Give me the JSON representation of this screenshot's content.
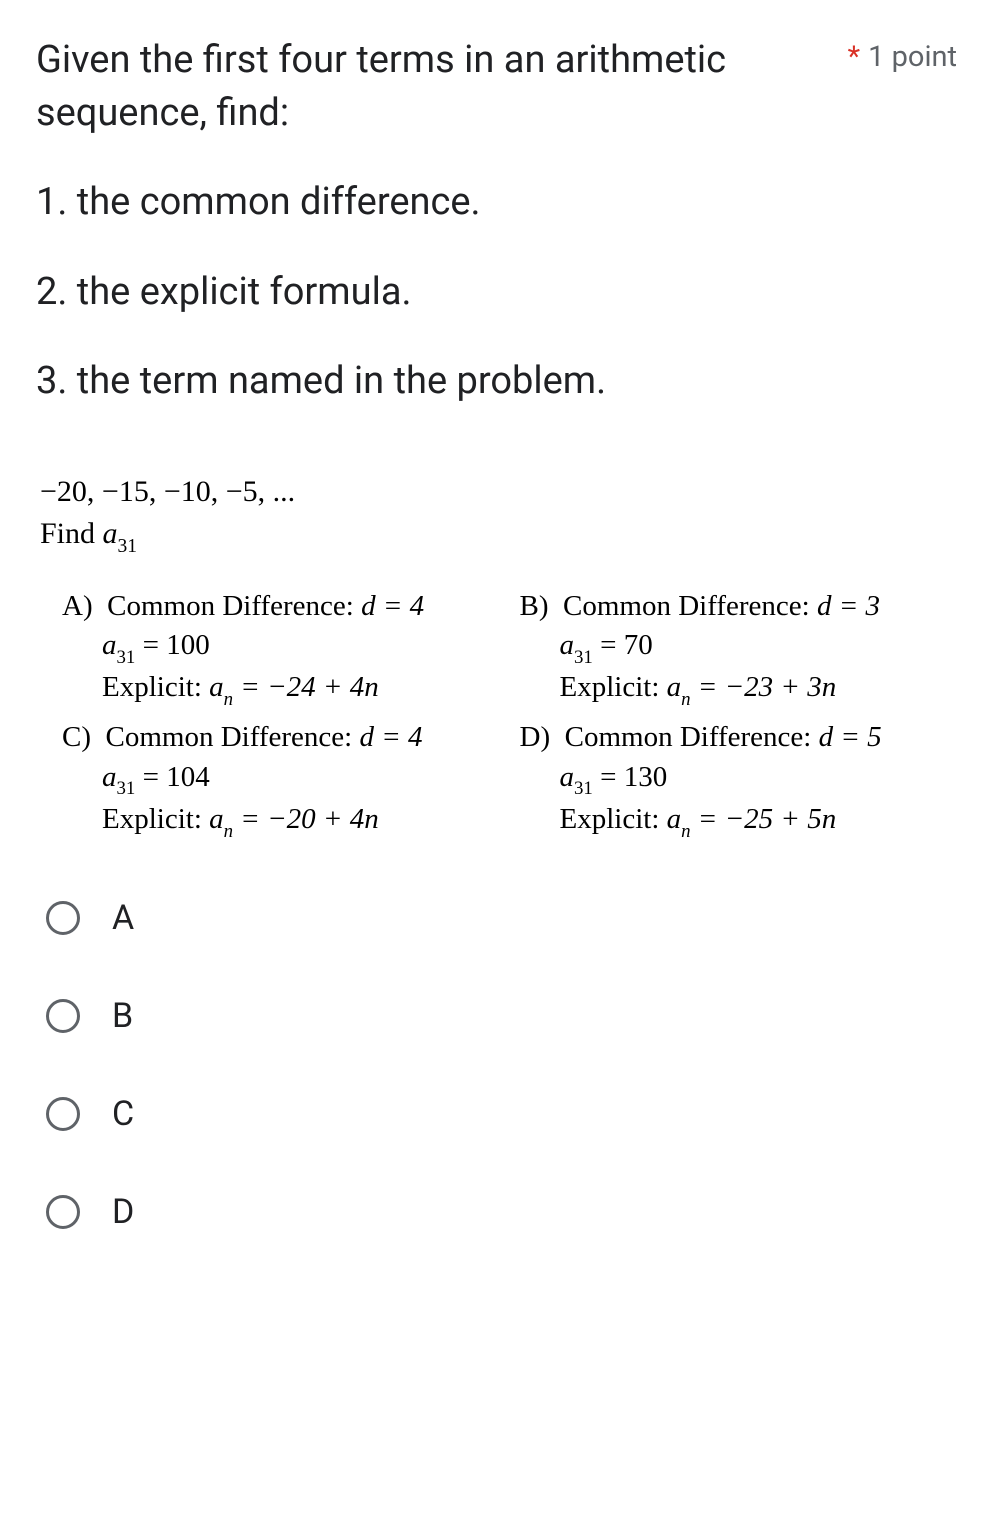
{
  "points_label": "1 point",
  "question_intro": "Given the first four terms in an arithmetic sequence, find:",
  "task1": "1. the common difference.",
  "task2": "2. the explicit formula.",
  "task3": "3. the term named in the problem.",
  "sequence": "−20,  −15,  −10,  −5, ...",
  "find_label_prefix": "Find ",
  "find_var": "a",
  "find_sub": "31",
  "answers": {
    "A": {
      "letter": "A)",
      "cd_label": "Common Difference: ",
      "cd_value": "d = 4",
      "term_prefix": "a",
      "term_sub": "31",
      "term_val": " = 100",
      "explicit_label": "Explicit: ",
      "explicit_var": "a",
      "explicit_sub": "n",
      "explicit_expr": " = −24 + 4n"
    },
    "B": {
      "letter": "B)",
      "cd_label": "Common Difference: ",
      "cd_value": "d = 3",
      "term_prefix": "a",
      "term_sub": "31",
      "term_val": " = 70",
      "explicit_label": "Explicit: ",
      "explicit_var": "a",
      "explicit_sub": "n",
      "explicit_expr": " = −23 + 3n"
    },
    "C": {
      "letter": "C)",
      "cd_label": "Common Difference: ",
      "cd_value": "d = 4",
      "term_prefix": "a",
      "term_sub": "31",
      "term_val": " = 104",
      "explicit_label": "Explicit: ",
      "explicit_var": "a",
      "explicit_sub": "n",
      "explicit_expr": " = −20 + 4n"
    },
    "D": {
      "letter": "D)",
      "cd_label": "Common Difference: ",
      "cd_value": "d = 5",
      "term_prefix": "a",
      "term_sub": "31",
      "term_val": " = 130",
      "explicit_label": "Explicit: ",
      "explicit_var": "a",
      "explicit_sub": "n",
      "explicit_expr": " = −25 + 5n"
    }
  },
  "options": [
    "A",
    "B",
    "C",
    "D"
  ]
}
